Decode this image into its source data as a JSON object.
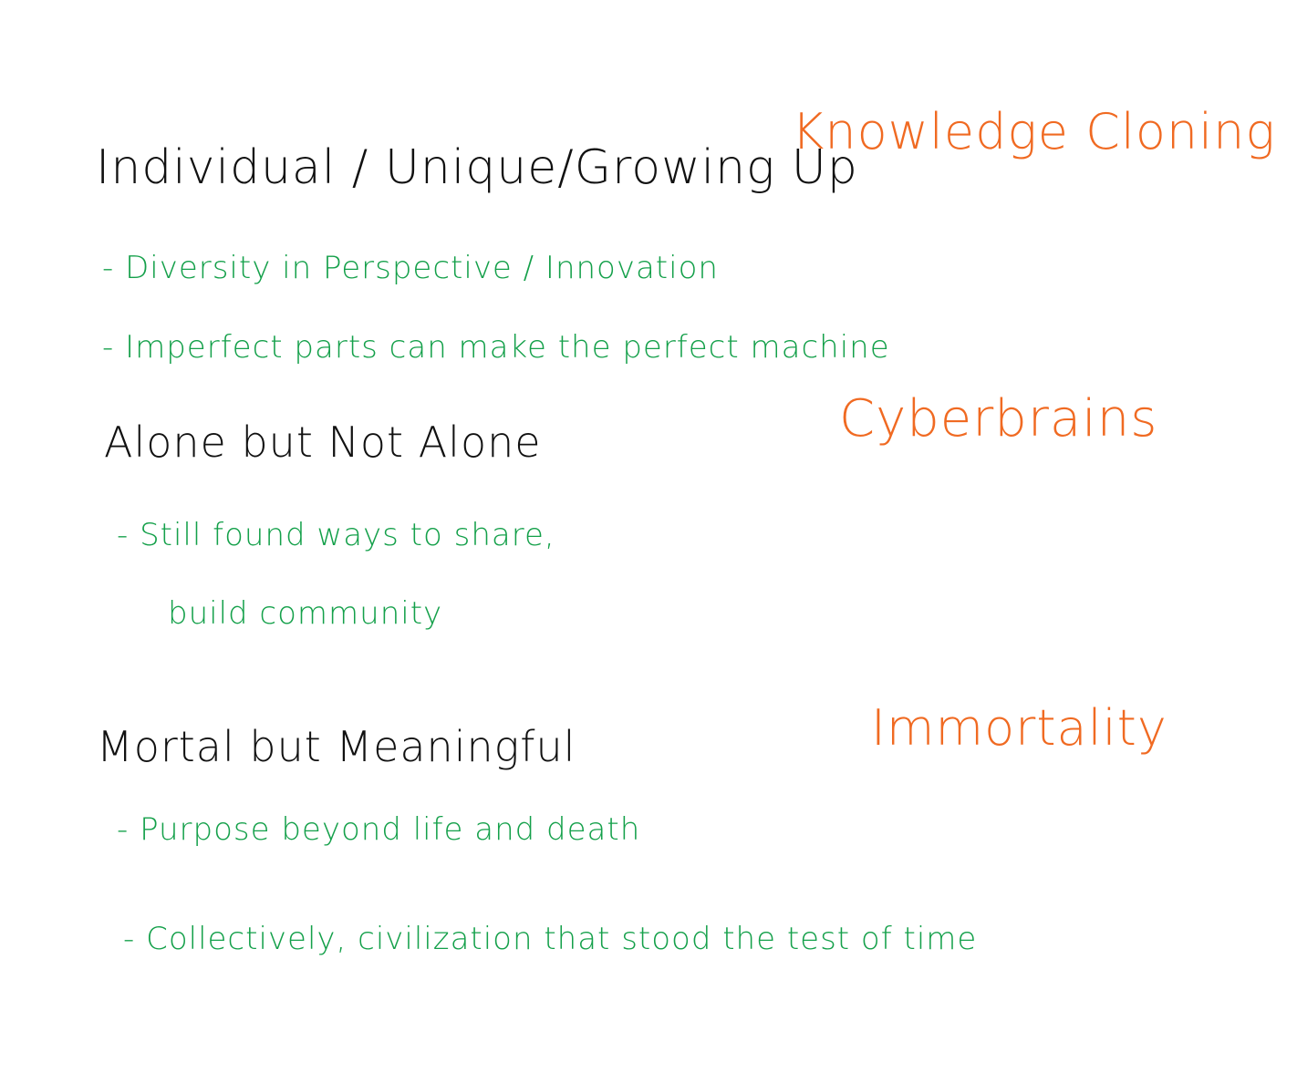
{
  "colors": {
    "background": "#ffffff",
    "heading": "#111111",
    "topic": "#f06a22",
    "point": "#14a04a"
  },
  "notes": {
    "heading_1": "Individual / Unique/Growing Up",
    "point_1": "- Diversity in Perspective / Innovation",
    "point_2": "- Imperfect parts can make the perfect machine",
    "heading_2": "Alone but Not Alone",
    "point_3_line1": "- Still found ways to share,",
    "point_3_line2": "build community",
    "heading_3": "Mortal but Meaningful",
    "point_4": "- Purpose beyond life and death",
    "point_5": "- Collectively, civilization that stood the test of time"
  },
  "topics": {
    "topic_1": "Knowledge Cloning",
    "topic_2": "Cyberbrains",
    "topic_3": "Immortality"
  }
}
